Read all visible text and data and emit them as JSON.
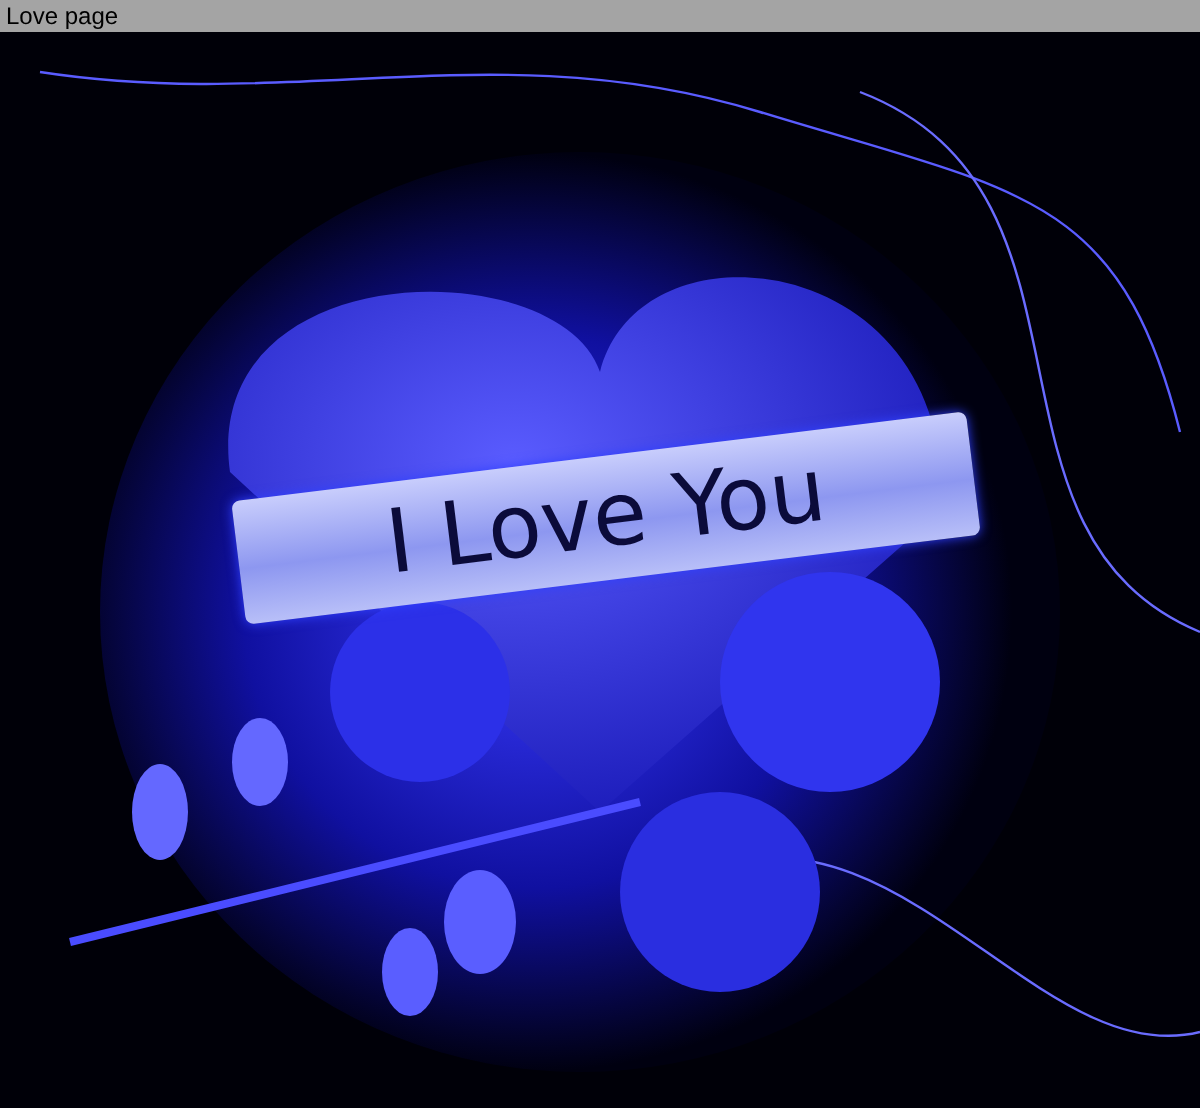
{
  "window": {
    "title": "Love page"
  },
  "image": {
    "kind": "picture",
    "banner": "I Love You"
  }
}
